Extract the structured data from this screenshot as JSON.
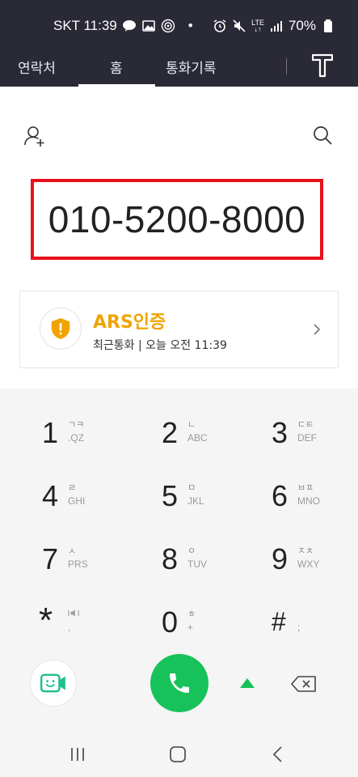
{
  "status": {
    "carrier_time": "SKT 11:39",
    "dot": "•",
    "lte": "LTE",
    "battery": "70%"
  },
  "tabs": {
    "contacts": "연락처",
    "home": "홈",
    "history": "통화기록"
  },
  "dialer": {
    "number": "010-5200-8000"
  },
  "recent": {
    "title": "ARS인증",
    "subtitle": "최근통화 | 오늘 오전 11:39"
  },
  "keys": [
    {
      "digit": "1",
      "kor": "ㄱㅋ",
      "eng": ".QZ"
    },
    {
      "digit": "2",
      "kor": "ㄴ",
      "eng": "ABC"
    },
    {
      "digit": "3",
      "kor": "ㄷㅌ",
      "eng": "DEF"
    },
    {
      "digit": "4",
      "kor": "ㄹ",
      "eng": "GHI"
    },
    {
      "digit": "5",
      "kor": "ㅁ",
      "eng": "JKL"
    },
    {
      "digit": "6",
      "kor": "ㅂㅍ",
      "eng": "MNO"
    },
    {
      "digit": "7",
      "kor": "ㅅ",
      "eng": "PRS"
    },
    {
      "digit": "8",
      "kor": "ㅇ",
      "eng": "TUV"
    },
    {
      "digit": "9",
      "kor": "ㅈㅊ",
      "eng": "WXY"
    },
    {
      "digit": "*",
      "kor": "",
      "eng": ","
    },
    {
      "digit": "0",
      "kor": "ㅎ",
      "eng": "+"
    },
    {
      "digit": "#",
      "kor": "",
      "eng": ";"
    }
  ],
  "colors": {
    "status_bg": "#2a2a36",
    "highlight_border": "#e8101c",
    "ars_title": "#f0a400",
    "call_green": "#17c25a",
    "video_green": "#1fbf8f"
  },
  "icons": {
    "add_contact": "add-contact-icon",
    "search": "search-icon",
    "shield": "shield-icon",
    "video": "video-call-icon",
    "call": "phone-icon",
    "backspace": "backspace-icon"
  }
}
